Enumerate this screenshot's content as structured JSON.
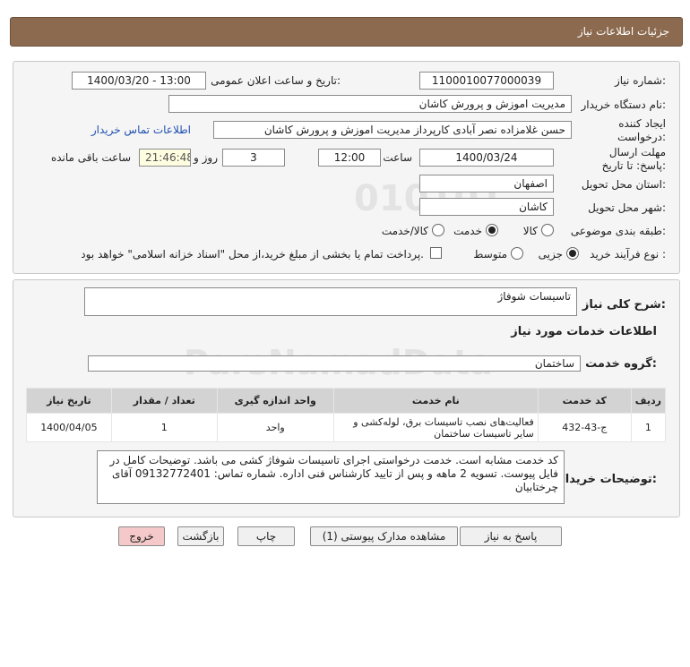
{
  "header": {
    "title": "جزئیات اطلاعات نیاز"
  },
  "form": {
    "need_number_label": "شماره نیاز:",
    "need_number": "1100010077000039",
    "announce_label": "تاریخ و ساعت اعلان عمومی:",
    "announce_value": "1400/03/20 - 13:00",
    "buyer_org_label": "نام دستگاه خریدار:",
    "buyer_org": "مدیریت اموزش و پرورش کاشان",
    "creator_label": "ایجاد کننده درخواست:",
    "creator": "حسن غلامزاده نصر آبادی کارپرداز مدیریت اموزش و پرورش کاشان",
    "contact_link": "اطلاعات تماس خریدار",
    "deadline_label": "مهلت ارسال پاسخ: تا تاریخ:",
    "deadline_date": "1400/03/24",
    "time_label": "ساعت",
    "deadline_time": "12:00",
    "days_value": "3",
    "days_label": "روز و",
    "remaining_time": "21:46:48",
    "remaining_label": "ساعت باقی مانده",
    "province_label": "استان محل تحویل:",
    "province": "اصفهان",
    "city_label": "شهر محل تحویل:",
    "city": "کاشان",
    "category_label": "طبقه بندی موضوعی:",
    "category_options": [
      "کالا",
      "خدمت",
      "کالا/خدمت"
    ],
    "category_selected": "خدمت",
    "process_label": "نوع فرآیند خرید :",
    "process_options": [
      "جزیی",
      "متوسط"
    ],
    "process_selected": "جزیی",
    "payment_note": "پرداخت تمام یا بخشی از مبلغ خرید،از محل \"اسناد خزانه اسلامی\" خواهد بود."
  },
  "details": {
    "summary_label": "شرح کلی نیاز:",
    "summary": "تاسیسات شوفاژ",
    "services_heading": "اطلاعات خدمات مورد نیاز",
    "group_label": "گروه خدمت:",
    "group_value": "ساختمان",
    "table": {
      "headers": [
        "ردیف",
        "کد خدمت",
        "نام خدمت",
        "واحد اندازه گیری",
        "تعداد / مقدار",
        "تاریخ نیاز"
      ],
      "rows": [
        [
          "1",
          "ج-43-432",
          "فعالیت‌های نصب تاسیسات برق، لوله‌کشی و سایر تاسیسات ساختمان",
          "واحد",
          "1",
          "1400/04/05"
        ]
      ]
    },
    "buyer_notes_label": "توضیحات خریدار:",
    "buyer_notes": "کد خدمت مشابه است. خدمت درخواستی اجرای تاسیسات شوفاژ کشی می باشد. توضیحات کامل در فایل پیوست. تسویه 2 ماهه و پس از تایید کارشناس فنی اداره. شماره تماس: 09132772401 آقای چرختابیان"
  },
  "buttons": {
    "reply": "پاسخ به نیاز",
    "attachments": "مشاهده مدارک پیوستی (1)",
    "print": "چاپ",
    "back": "بازگشت",
    "exit": "خروج"
  },
  "colors": {
    "header_bg": "#8c6a4f",
    "exit_bg": "#f5c9c9",
    "timer_bg": "#fffde0",
    "link": "#2050b0"
  }
}
